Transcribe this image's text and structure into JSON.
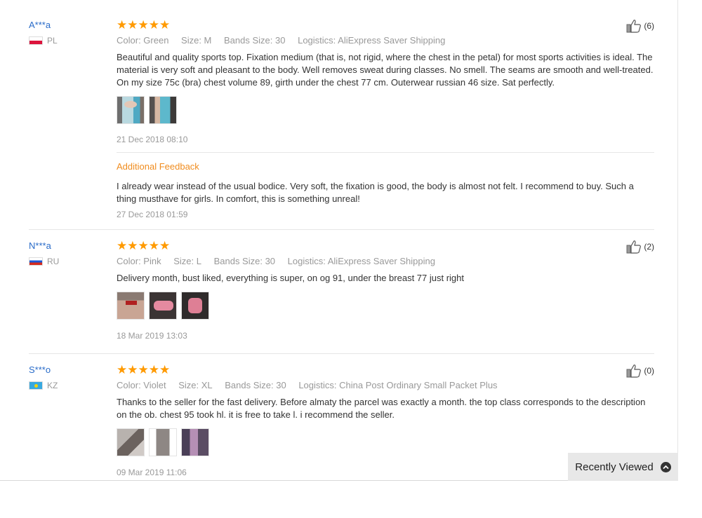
{
  "reviews": [
    {
      "user": "A***a",
      "country": "PL",
      "stars": "★★★★★",
      "meta": {
        "color": "Color: Green",
        "size": "Size: M",
        "bands": "Bands Size: 30",
        "logistics": "Logistics: AliExpress Saver Shipping"
      },
      "text": "Beautiful and quality sports top. Fixation medium (that is, not rigid, where the chest in the petal) for most sports activities is ideal. The material is very soft and pleasant to the body. Well removes sweat during classes. No smell. The seams are smooth and well-treated. On my size 75c (bra) chest volume 89, girth under the chest 77 cm. Outerwear russian 46 size. Sat perfectly.",
      "date": "21 Dec 2018 08:10",
      "helpful": "(6)",
      "additional": {
        "title": "Additional Feedback",
        "text": "I already wear instead of the usual bodice. Very soft, the fixation is good, the body is almost not felt. I recommend to buy. Such a thing musthave for girls. In comfort, this is something unreal!",
        "date": "27 Dec 2018 01:59"
      }
    },
    {
      "user": "N***a",
      "country": "RU",
      "stars": "★★★★★",
      "meta": {
        "color": "Color: Pink",
        "size": "Size: L",
        "bands": "Bands Size: 30",
        "logistics": "Logistics: AliExpress Saver Shipping"
      },
      "text": "Delivery month, bust liked, everything is super, on og 91, under the breast 77 just right",
      "date": "18 Mar 2019 13:03",
      "helpful": "(2)"
    },
    {
      "user": "S***o",
      "country": "KZ",
      "stars": "★★★★★",
      "meta": {
        "color": "Color: Violet",
        "size": "Size: XL",
        "bands": "Bands Size: 30",
        "logistics": "Logistics: China Post Ordinary Small Packet Plus"
      },
      "text": "Thanks to the seller for the fast delivery. Before almaty the parcel was exactly a month. the top class corresponds to the description on the ob. chest 95 took hl. it is free to take l. i recommend the seller.",
      "date": "09 Mar 2019 11:06",
      "helpful": "(0)"
    }
  ],
  "recently_viewed": "Recently Viewed",
  "colors": {
    "star": "#ff9a00",
    "username": "#2a6cc9",
    "additional_title": "#f08c1e"
  }
}
